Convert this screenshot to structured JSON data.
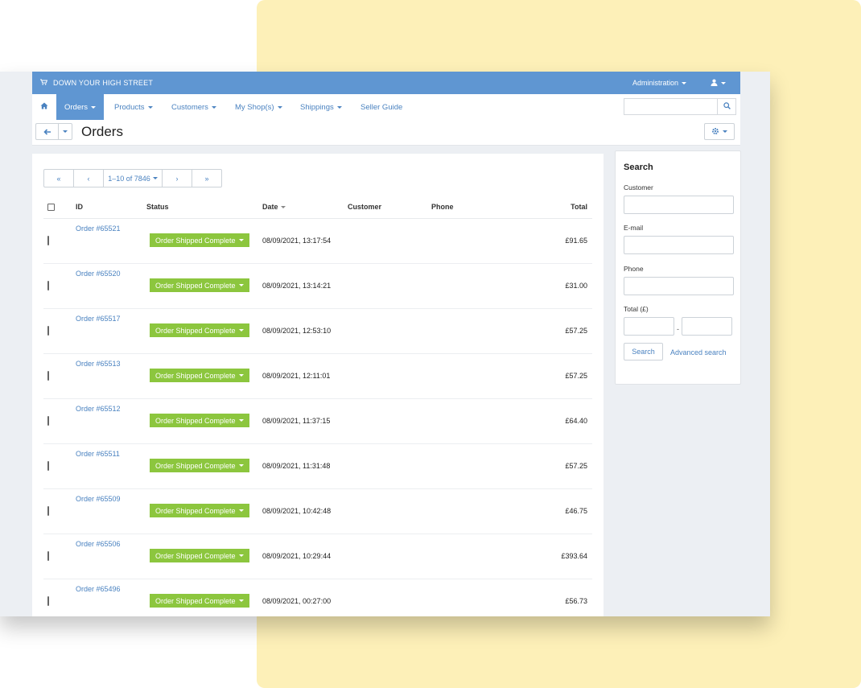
{
  "topbar": {
    "brand": "DOWN YOUR HIGH STREET",
    "admin_label": "Administration",
    "icons": {
      "cart": "cart-icon",
      "user": "user-icon"
    }
  },
  "nav": {
    "items": [
      {
        "label": "Orders",
        "active": true
      },
      {
        "label": "Products"
      },
      {
        "label": "Customers"
      },
      {
        "label": "My Shop(s)"
      },
      {
        "label": "Shippings"
      },
      {
        "label": "Seller Guide"
      }
    ],
    "search_value": ""
  },
  "page": {
    "title": "Orders"
  },
  "pager": {
    "first": "«",
    "prev": "‹",
    "range": "1–10 of 7846",
    "next": "›",
    "last": "»"
  },
  "table": {
    "headers": {
      "id": "ID",
      "status": "Status",
      "date": "Date",
      "customer": "Customer",
      "phone": "Phone",
      "total": "Total"
    },
    "rows": [
      {
        "id": "Order #65521",
        "status": "Order Shipped Complete",
        "date": "08/09/2021, 13:17:54",
        "customer": "",
        "phone": "",
        "total": "£91.65"
      },
      {
        "id": "Order #65520",
        "status": "Order Shipped Complete",
        "date": "08/09/2021, 13:14:21",
        "customer": "",
        "phone": "",
        "total": "£31.00"
      },
      {
        "id": "Order #65517",
        "status": "Order Shipped Complete",
        "date": "08/09/2021, 12:53:10",
        "customer": "",
        "phone": "",
        "total": "£57.25"
      },
      {
        "id": "Order #65513",
        "status": "Order Shipped Complete",
        "date": "08/09/2021, 12:11:01",
        "customer": "",
        "phone": "",
        "total": "£57.25"
      },
      {
        "id": "Order #65512",
        "status": "Order Shipped Complete",
        "date": "08/09/2021, 11:37:15",
        "customer": "",
        "phone": "",
        "total": "£64.40"
      },
      {
        "id": "Order #65511",
        "status": "Order Shipped Complete",
        "date": "08/09/2021, 11:31:48",
        "customer": "",
        "phone": "",
        "total": "£57.25"
      },
      {
        "id": "Order #65509",
        "status": "Order Shipped Complete",
        "date": "08/09/2021, 10:42:48",
        "customer": "",
        "phone": "",
        "total": "£46.75"
      },
      {
        "id": "Order #65506",
        "status": "Order Shipped Complete",
        "date": "08/09/2021, 10:29:44",
        "customer": "",
        "phone": "",
        "total": "£393.64"
      },
      {
        "id": "Order #65496",
        "status": "Order Shipped Complete",
        "date": "08/09/2021, 00:27:00",
        "customer": "",
        "phone": "",
        "total": "£56.73"
      }
    ]
  },
  "search_panel": {
    "title": "Search",
    "customer_label": "Customer",
    "email_label": "E-mail",
    "phone_label": "Phone",
    "total_label": "Total (£)",
    "range_sep": "-",
    "search_button": "Search",
    "advanced_link": "Advanced search"
  },
  "colors": {
    "brand_blue": "#5f96d2",
    "link_blue": "#4a82c0",
    "status_green": "#8cc63e",
    "accent_yellow": "#fdf0b8"
  }
}
